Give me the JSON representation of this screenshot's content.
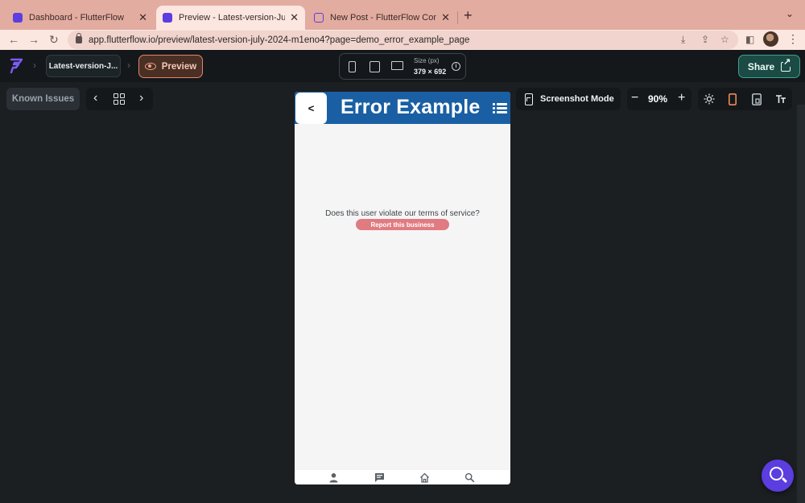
{
  "browser": {
    "tabs": [
      {
        "title": "Dashboard - FlutterFlow",
        "active": false
      },
      {
        "title": "Preview - Latest-version-July-",
        "active": true
      },
      {
        "title": "New Post - FlutterFlow Commu",
        "active": false
      }
    ],
    "url": "app.flutterflow.io/preview/latest-version-july-2024-m1eno4?page=demo_error_example_page"
  },
  "topbar": {
    "project_name": "Latest-version-J...",
    "preview_label": "Preview",
    "size_label": "Size (px)",
    "size_value": "379 × 692",
    "share_label": "Share"
  },
  "toolbar": {
    "known_issues_label": "Known Issues",
    "screenshot_mode_label": "Screenshot Mode",
    "zoom_level": "90%"
  },
  "app": {
    "title": "Error Example",
    "back_label": "<",
    "question": "Does this user violate our terms of service?",
    "report_button": "Report this business",
    "bottom_nav": [
      "person-icon",
      "chat-icon",
      "home-icon",
      "search-icon"
    ]
  },
  "colors": {
    "app_bar": "#1a5fa3",
    "report_button": "#e07b82",
    "preview_accent": "#e5856a",
    "share_accent": "#3aa38f",
    "fab": "#5b3de0"
  }
}
